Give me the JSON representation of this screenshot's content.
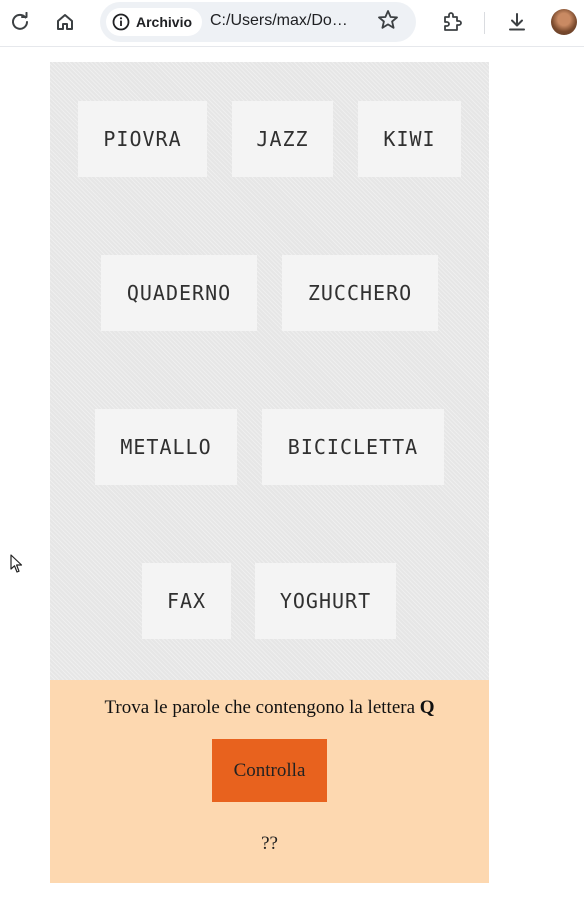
{
  "browser": {
    "site_chip_label": "Archivio",
    "url": "C:/Users/max/Do…",
    "icons": [
      "reload-icon",
      "home-icon",
      "info-icon",
      "star-icon",
      "extensions-icon",
      "download-icon",
      "profile-avatar"
    ]
  },
  "game": {
    "words": [
      "PIOVRA",
      "JAZZ",
      "KIWI",
      "QUADERNO",
      "ZUCCHERO",
      "METALLO",
      "BICICLETTA",
      "FAX",
      "YOGHURT"
    ]
  },
  "footer": {
    "instruction_prefix": "Trova le parole che contengono la lettera",
    "target_letter": "Q",
    "check_button_label": "Controlla",
    "result_text": "??"
  },
  "colors": {
    "game_background": "#e6e6e6",
    "tile_background": "#f4f4f4",
    "footer_background": "#fdd8b0",
    "button_color": "#e8621e"
  }
}
